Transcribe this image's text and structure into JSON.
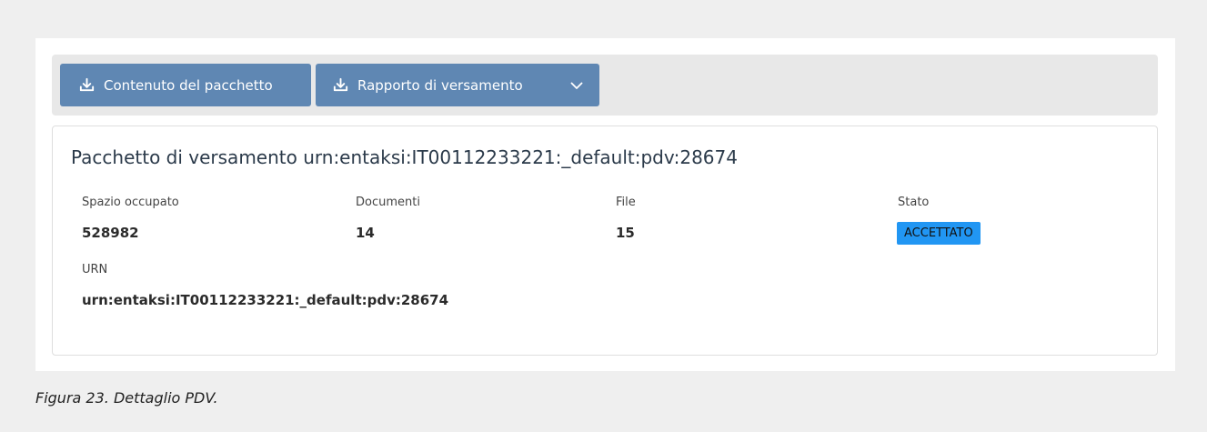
{
  "toolbar": {
    "content_button_label": "Contenuto del pacchetto",
    "report_button_label": "Rapporto di versamento"
  },
  "card": {
    "title": "Pacchetto di versamento urn:entaksi:IT00112233221:_default:pdv:28674",
    "fields": {
      "space": {
        "label": "Spazio occupato",
        "value": "528982"
      },
      "documents": {
        "label": "Documenti",
        "value": "14"
      },
      "files": {
        "label": "File",
        "value": "15"
      },
      "status": {
        "label": "Stato",
        "value": "ACCETTATO"
      },
      "urn": {
        "label": "URN",
        "value": "urn:entaksi:IT00112233221:_default:pdv:28674"
      }
    }
  },
  "caption": "Figura 23. Dettaglio PDV.",
  "colors": {
    "button": "#5f87b3",
    "badge": "#2196f3",
    "toolbar": "#e8e8e8",
    "page_background": "#efefef"
  },
  "icons": {
    "download": "download-icon",
    "dropdown": "chevron-down-icon"
  }
}
